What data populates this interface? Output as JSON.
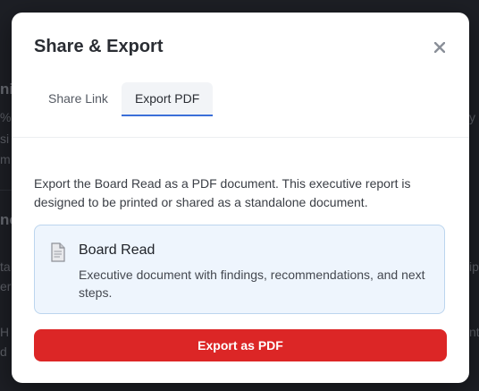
{
  "background": {
    "fragments": [
      "nis",
      "%",
      "si",
      "m",
      "nc",
      "ta",
      "er",
      "H",
      "d",
      "y i",
      "ip",
      "nt/"
    ]
  },
  "dialog": {
    "title": "Share & Export",
    "close_icon": "close-icon",
    "tabs": [
      {
        "label": "Share Link",
        "active": false
      },
      {
        "label": "Export PDF",
        "active": true
      }
    ],
    "description": "Export the Board Read as a PDF document. This executive report is designed to be printed or shared as a standalone document.",
    "option": {
      "icon": "document-icon",
      "title": "Board Read",
      "description": "Executive document with findings, recommendations, and next steps."
    },
    "export_button_label": "Export as PDF"
  },
  "colors": {
    "accent_blue": "#3b6fd8",
    "export_red": "#dc2626",
    "card_bg": "#eef5fd",
    "card_border": "#bcd5ee"
  }
}
